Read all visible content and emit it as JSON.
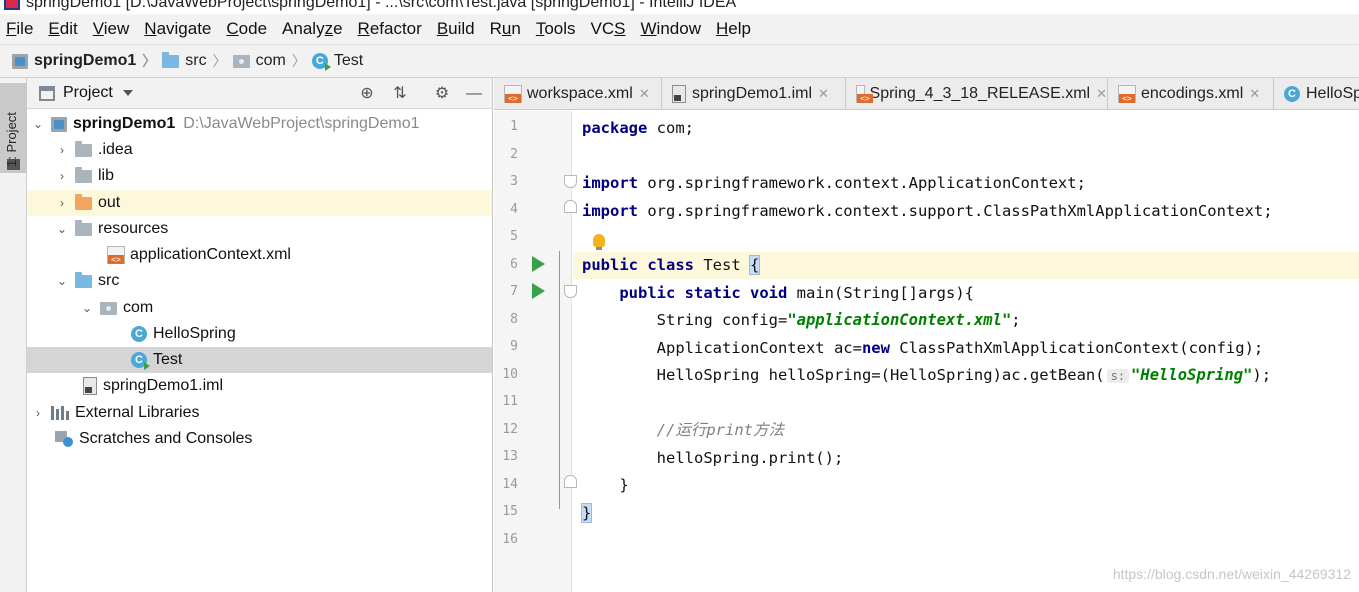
{
  "window": {
    "title": "springDemo1 [D:\\JavaWebProject\\springDemo1] - ...\\src\\com\\Test.java [springDemo1] - IntelliJ IDEA"
  },
  "menu": [
    "File",
    "Edit",
    "View",
    "Navigate",
    "Code",
    "Analyze",
    "Refactor",
    "Build",
    "Run",
    "Tools",
    "VCS",
    "Window",
    "Help"
  ],
  "menu_mnemonics": [
    "F",
    "E",
    "V",
    "N",
    "C",
    "z",
    "R",
    "B",
    "u",
    "T",
    "S",
    "W",
    "H"
  ],
  "breadcrumb": [
    "springDemo1",
    "src",
    "com",
    "Test"
  ],
  "tool_strip": {
    "project_tab": "1: Project"
  },
  "project_panel": {
    "title": "Project",
    "tree": [
      {
        "label": "springDemo1",
        "path": "D:\\JavaWebProject\\springDemo1",
        "icon": "module-icon",
        "expanded": true
      },
      {
        "label": ".idea",
        "icon": "folder-icon",
        "expanded": false
      },
      {
        "label": "lib",
        "icon": "folder-icon",
        "expanded": false
      },
      {
        "label": "out",
        "icon": "folder-excluded-icon",
        "expanded": false
      },
      {
        "label": "resources",
        "icon": "resources-folder-icon",
        "expanded": true
      },
      {
        "label": "applicationContext.xml",
        "icon": "xml-file-icon"
      },
      {
        "label": "src",
        "icon": "source-folder-icon",
        "expanded": true
      },
      {
        "label": "com",
        "icon": "package-icon",
        "expanded": true
      },
      {
        "label": "HelloSpring",
        "icon": "class-icon"
      },
      {
        "label": "Test",
        "icon": "runnable-class-icon",
        "selected": true
      },
      {
        "label": "springDemo1.iml",
        "icon": "iml-file-icon"
      },
      {
        "label": "External Libraries",
        "icon": "libraries-icon",
        "expanded": false
      },
      {
        "label": "Scratches and Consoles",
        "icon": "scratches-icon"
      }
    ]
  },
  "editor_tabs": [
    "workspace.xml",
    "springDemo1.iml",
    "Spring_4_3_18_RELEASE.xml",
    "encodings.xml",
    "HelloSp"
  ],
  "editor": {
    "line_numbers": [
      "1",
      "2",
      "3",
      "4",
      "5",
      "6",
      "7",
      "8",
      "9",
      "10",
      "11",
      "12",
      "13",
      "14",
      "15",
      "16"
    ],
    "line1": {
      "kw": "package",
      "rest": " com;"
    },
    "line3": {
      "kw": "import",
      "rest": " org.springframework.context.ApplicationContext;"
    },
    "line4": {
      "kw": "import",
      "rest": " org.springframework.context.support.ClassPathXmlApplicationContext;"
    },
    "line6": {
      "kw1": "public",
      "kw2": "class",
      "name": " Test ",
      "brace": "{"
    },
    "line7": {
      "indent": "    ",
      "kw1": "public",
      "kw2": "static",
      "kw3": "void",
      "rest": " main(String[]args){"
    },
    "line8": {
      "pre": "        String config=",
      "str": "\"applicationContext.xml\"",
      "post": ";"
    },
    "line9": {
      "pre": "        ApplicationContext ac=",
      "kw": "new",
      "post": " ClassPathXmlApplicationContext(config);"
    },
    "line10": {
      "pre": "        HelloSpring helloSpring=(HelloSpring)ac.getBean(",
      "hint": "s:",
      "str": "\"HelloSpring\"",
      "post": ");"
    },
    "line12": {
      "indent": "        ",
      "comment": "//运行print方法"
    },
    "line13": {
      "text": "        helloSpring.print();"
    },
    "line14": {
      "text": "    }"
    },
    "line15": {
      "brace": "}"
    }
  },
  "watermark": "https://blog.csdn.net/weixin_44269312",
  "colors": {
    "keyword": "#000080",
    "string": "#008000",
    "comment": "#808080",
    "caret_line": "#fdf8dc",
    "selection": "#d5d5d5"
  }
}
